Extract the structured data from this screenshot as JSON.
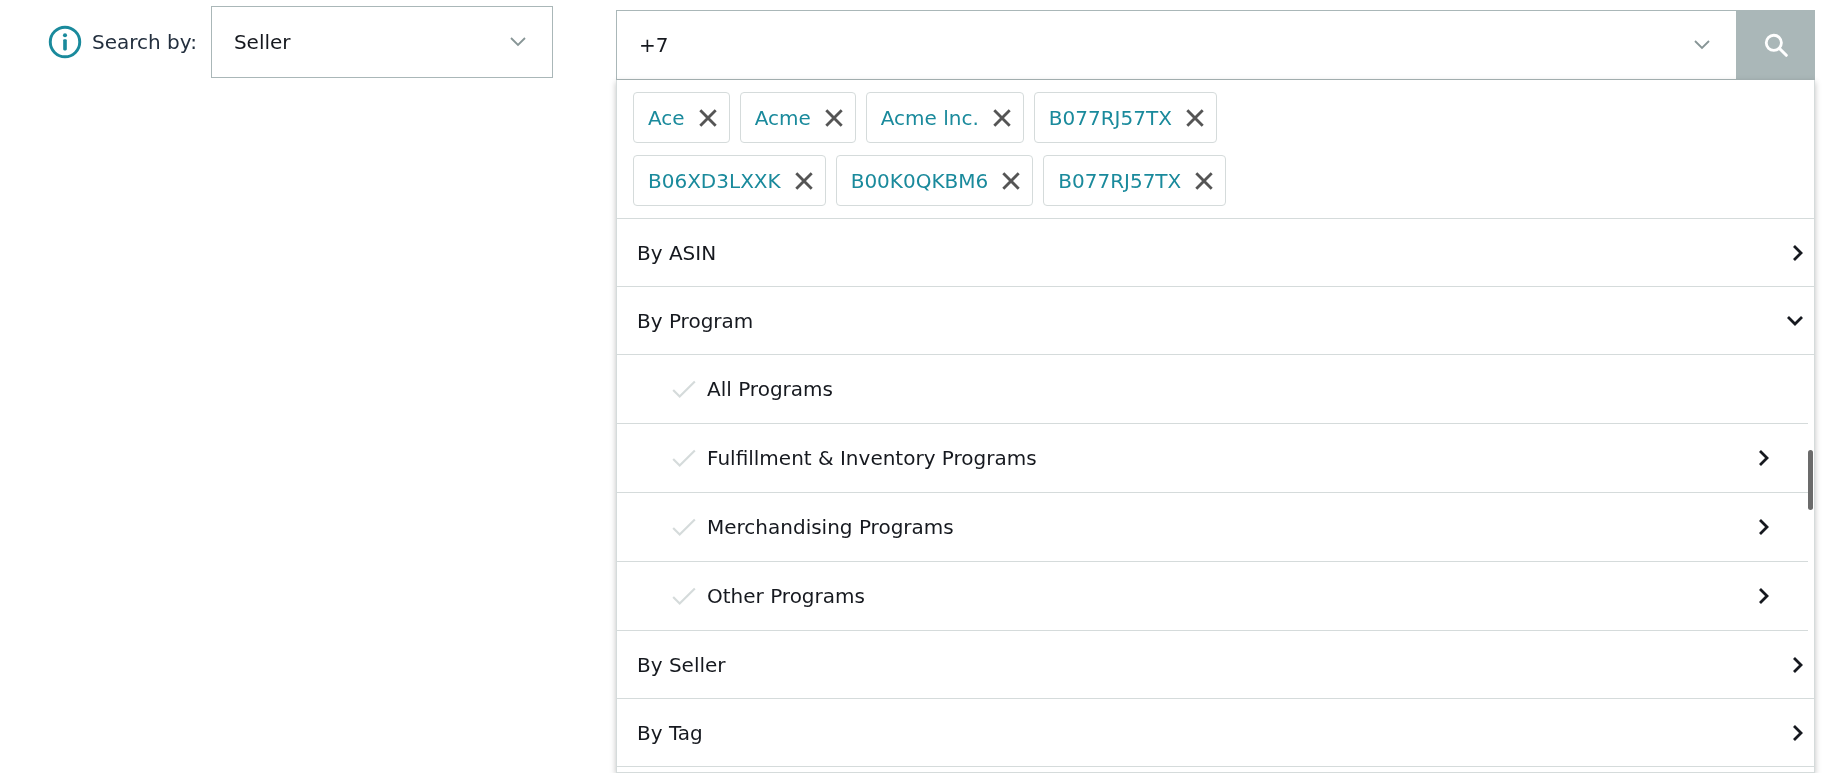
{
  "search_by": {
    "label": "Search by:",
    "value": "Seller"
  },
  "search": {
    "value": "+7"
  },
  "tokens": [
    {
      "label": "Ace"
    },
    {
      "label": "Acme"
    },
    {
      "label": "Acme lnc."
    },
    {
      "label": "B077RJ57TX"
    },
    {
      "label": "B06XD3LXXK"
    },
    {
      "label": "B00K0QKBM6"
    },
    {
      "label": "B077RJ57TX"
    }
  ],
  "categories": [
    {
      "label": "By ASIN",
      "expanded": false
    },
    {
      "label": "By Program",
      "expanded": true,
      "children": [
        {
          "label": "All Programs",
          "checked": false,
          "kind": "option"
        },
        {
          "label": "Fulfillment & Inventory Programs",
          "checked": false,
          "kind": "submenu"
        },
        {
          "label": "Merchandising Programs",
          "checked": false,
          "kind": "submenu"
        },
        {
          "label": "Other Programs",
          "checked": false,
          "kind": "submenu"
        }
      ]
    },
    {
      "label": "By Seller",
      "expanded": false
    },
    {
      "label": "By Tag",
      "expanded": false
    }
  ]
}
